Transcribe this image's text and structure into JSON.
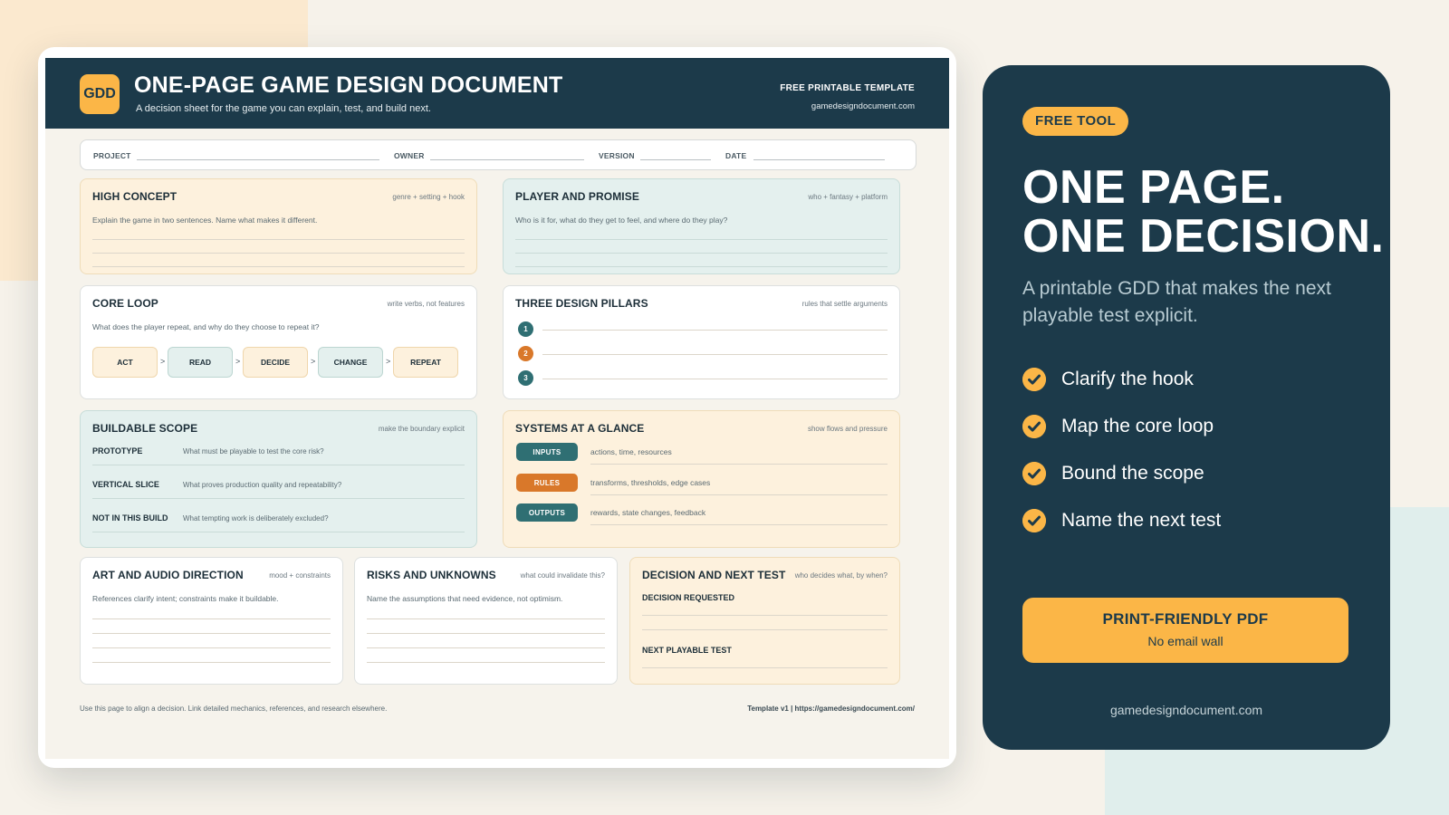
{
  "header": {
    "logo": "GDD",
    "title": "ONE-PAGE GAME DESIGN DOCUMENT",
    "subtitle": "A decision sheet for the game you can explain, test, and build next.",
    "free_label": "FREE PRINTABLE TEMPLATE",
    "site": "gamedesigndocument.com"
  },
  "meta": {
    "project": "PROJECT",
    "owner": "OWNER",
    "version": "VERSION",
    "date": "DATE"
  },
  "high_concept": {
    "title": "HIGH CONCEPT",
    "hint": "genre + setting + hook",
    "prompt": "Explain the game in two sentences. Name what makes it different."
  },
  "player_promise": {
    "title": "PLAYER AND PROMISE",
    "hint": "who + fantasy + platform",
    "prompt": "Who is it for, what do they get to feel, and where do they play?"
  },
  "core_loop": {
    "title": "CORE LOOP",
    "hint": "write verbs, not features",
    "prompt": "What does the player repeat, and why do they choose to repeat it?",
    "steps": [
      "ACT",
      "READ",
      "DECIDE",
      "CHANGE",
      "REPEAT"
    ],
    "separator": ">"
  },
  "pillars": {
    "title": "THREE DESIGN PILLARS",
    "hint": "rules that settle arguments",
    "numbers": [
      "1",
      "2",
      "3"
    ]
  },
  "scope": {
    "title": "BUILDABLE SCOPE",
    "hint": "make the boundary explicit",
    "rows": [
      {
        "label": "PROTOTYPE",
        "text": "What must be playable to test the core risk?"
      },
      {
        "label": "VERTICAL SLICE",
        "text": "What proves production quality and repeatability?"
      },
      {
        "label": "NOT IN THIS BUILD",
        "text": "What tempting work is deliberately excluded?"
      }
    ]
  },
  "systems": {
    "title": "SYSTEMS AT A GLANCE",
    "hint": "show flows and pressure",
    "rows": [
      {
        "tag": "INPUTS",
        "text": "actions, time, resources"
      },
      {
        "tag": "RULES",
        "text": "transforms, thresholds, edge cases"
      },
      {
        "tag": "OUTPUTS",
        "text": "rewards, state changes, feedback"
      }
    ]
  },
  "art": {
    "title": "ART AND AUDIO DIRECTION",
    "hint": "mood + constraints",
    "prompt": "References clarify intent; constraints make it buildable."
  },
  "risks": {
    "title": "RISKS AND UNKNOWNS",
    "hint": "what could invalidate this?",
    "prompt": "Name the assumptions that need evidence, not optimism."
  },
  "decision": {
    "title": "DECISION AND NEXT TEST",
    "hint": "who decides what, by when?",
    "requested": "DECISION REQUESTED",
    "next_test": "NEXT PLAYABLE TEST"
  },
  "footer": {
    "left": "Use this page to align a decision. Link detailed mechanics, references, and research elsewhere.",
    "right": "Template v1 | https://gamedesigndocument.com/"
  },
  "panel": {
    "badge": "FREE TOOL",
    "headline_1": "ONE PAGE.",
    "headline_2": "ONE DECISION.",
    "lead": "A printable GDD that makes the next playable test explicit.",
    "checks": [
      "Clarify the hook",
      "Map the core loop",
      "Bound the scope",
      "Name the next test"
    ],
    "cta_title": "PRINT-FRIENDLY PDF",
    "cta_sub": "No email wall",
    "site": "gamedesigndocument.com"
  },
  "colors": {
    "navy": "#1c3a4a",
    "amber": "#fbb647",
    "teal": "#2f6f73",
    "orange": "#d9782a",
    "cream": "#fdf1dd",
    "mint": "#e4f0ee"
  },
  "icons": {
    "check": "check-circle-icon"
  }
}
